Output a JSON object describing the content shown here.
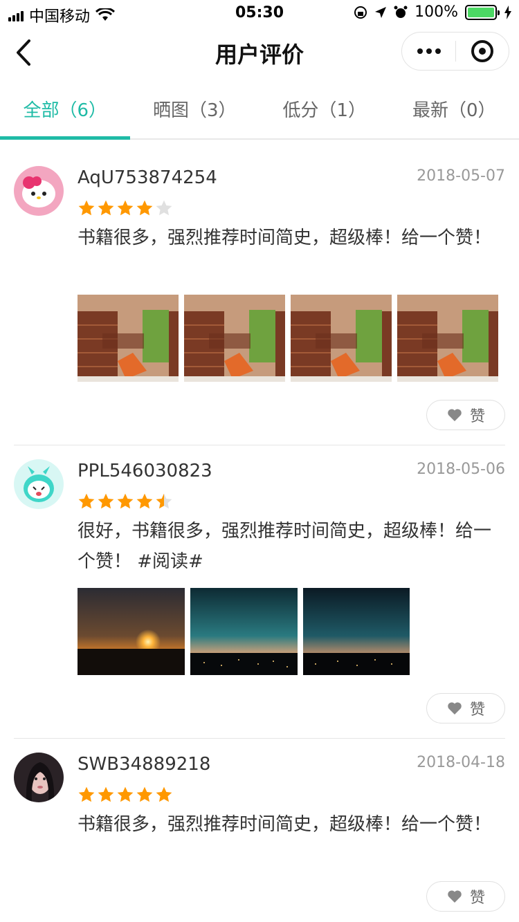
{
  "status_bar": {
    "carrier": "中国移动",
    "time": "05:30",
    "battery": "100%"
  },
  "nav": {
    "title": "用户评价"
  },
  "tabs": [
    {
      "label": "全部（6）",
      "active": true
    },
    {
      "label": "晒图（3）",
      "active": false
    },
    {
      "label": "低分（1）",
      "active": false
    },
    {
      "label": "最新（0）",
      "active": false
    }
  ],
  "colors": {
    "accent": "#1fbba6",
    "star": "#ff9800",
    "star_empty": "#e0e0e0"
  },
  "reviews": [
    {
      "username": "AqU753874254",
      "date": "2018-05-07",
      "rating": 4,
      "content": "书籍很多，强烈推荐时间简史，超级棒！给一个赞！",
      "images": [
        "book-cover-image",
        "book-cover-image",
        "book-cover-image",
        "book-cover-image"
      ],
      "like_label": "赞",
      "avatar": "hello-kitty-avatar"
    },
    {
      "username": "PPL546030823",
      "date": "2018-05-06",
      "rating": 4.5,
      "content": "很好，书籍很多，强烈推荐时间简史，超级棒！给一个赞！ #阅读#",
      "images": [
        "sunset-photo",
        "night-city-photo",
        "night-city-photo"
      ],
      "like_label": "赞",
      "avatar": "cartoon-avatar"
    },
    {
      "username": "SWB34889218",
      "date": "2018-04-18",
      "rating": 5,
      "content": "书籍很多，强烈推荐时间简史，超级棒！给一个赞！",
      "images": [],
      "like_label": "赞",
      "avatar": "photo-avatar"
    }
  ]
}
